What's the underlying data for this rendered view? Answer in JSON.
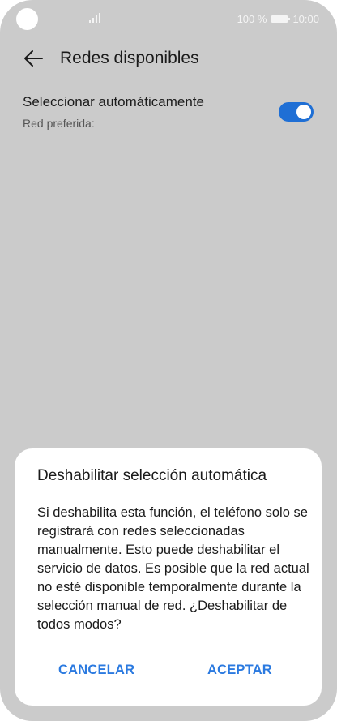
{
  "status": {
    "battery_percent": "100 %",
    "time": "10:00"
  },
  "appbar": {
    "title": "Redes disponibles"
  },
  "setting": {
    "title": "Seleccionar automáticamente",
    "subtitle": "Red preferida:",
    "enabled": true
  },
  "dialog": {
    "title": "Deshabilitar selección automática",
    "message": "Si deshabilita esta función, el teléfono solo se registrará con redes seleccionadas manualmente. Esto puede deshabilitar el servicio de datos. Es posible que la red actual no esté disponible temporalmente durante la selección manual de red. ¿Deshabilitar de todos modos?",
    "cancel": "CANCELAR",
    "accept": "ACEPTAR"
  },
  "colors": {
    "accent": "#1f6fd5",
    "button_text": "#2b7ae0",
    "background": "#cbcbcb"
  }
}
